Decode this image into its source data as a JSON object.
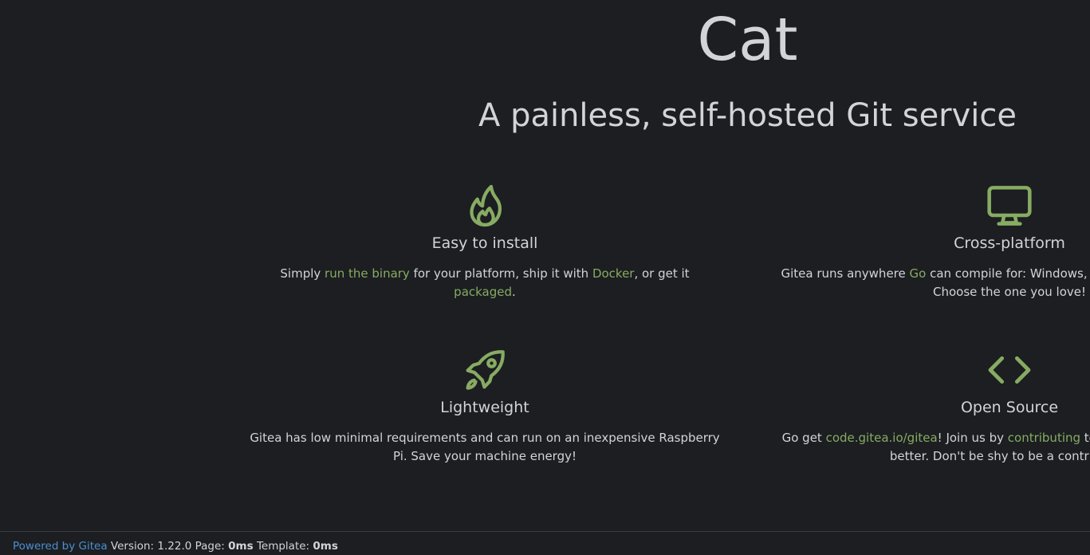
{
  "site": {
    "title": "Cat",
    "tagline": "A painless, self-hosted Git service"
  },
  "colors": {
    "background": "#1c1e21",
    "text": "#d2d4d8",
    "accent_green": "#87ab63",
    "link_blue": "#4a8fd1"
  },
  "features": {
    "install": {
      "icon": "flame-icon",
      "title": "Easy to install",
      "text_1": "Simply ",
      "link_1": "run the binary",
      "text_2": " for your platform, ship it with ",
      "link_2": "Docker",
      "text_3": ", or get it ",
      "link_3": "packaged",
      "text_4": "."
    },
    "platform": {
      "icon": "monitor-icon",
      "title": "Cross-platform",
      "text_1": "Gitea runs anywhere ",
      "link_1": "Go",
      "text_2": " can compile for: Windows, macOS, Linux, ARM, etc. Choose the one you love!"
    },
    "lightweight": {
      "icon": "rocket-icon",
      "title": "Lightweight",
      "text_1": "Gitea has low minimal requirements and can run on an inexpensive Raspberry Pi. Save your machine energy!"
    },
    "opensource": {
      "icon": "code-icon",
      "title": "Open Source",
      "text_1": "Go get ",
      "link_1": "code.gitea.io/gitea",
      "text_2": "! Join us by ",
      "link_2": "contributing",
      "text_3": " to make this project even better. Don't be shy to be a contributor!"
    }
  },
  "footer": {
    "powered_by": "Powered by Gitea",
    "version_label": " Version: 1.22.0 Page: ",
    "page_time": "0ms",
    "template_label": " Template: ",
    "template_time": "0ms"
  }
}
